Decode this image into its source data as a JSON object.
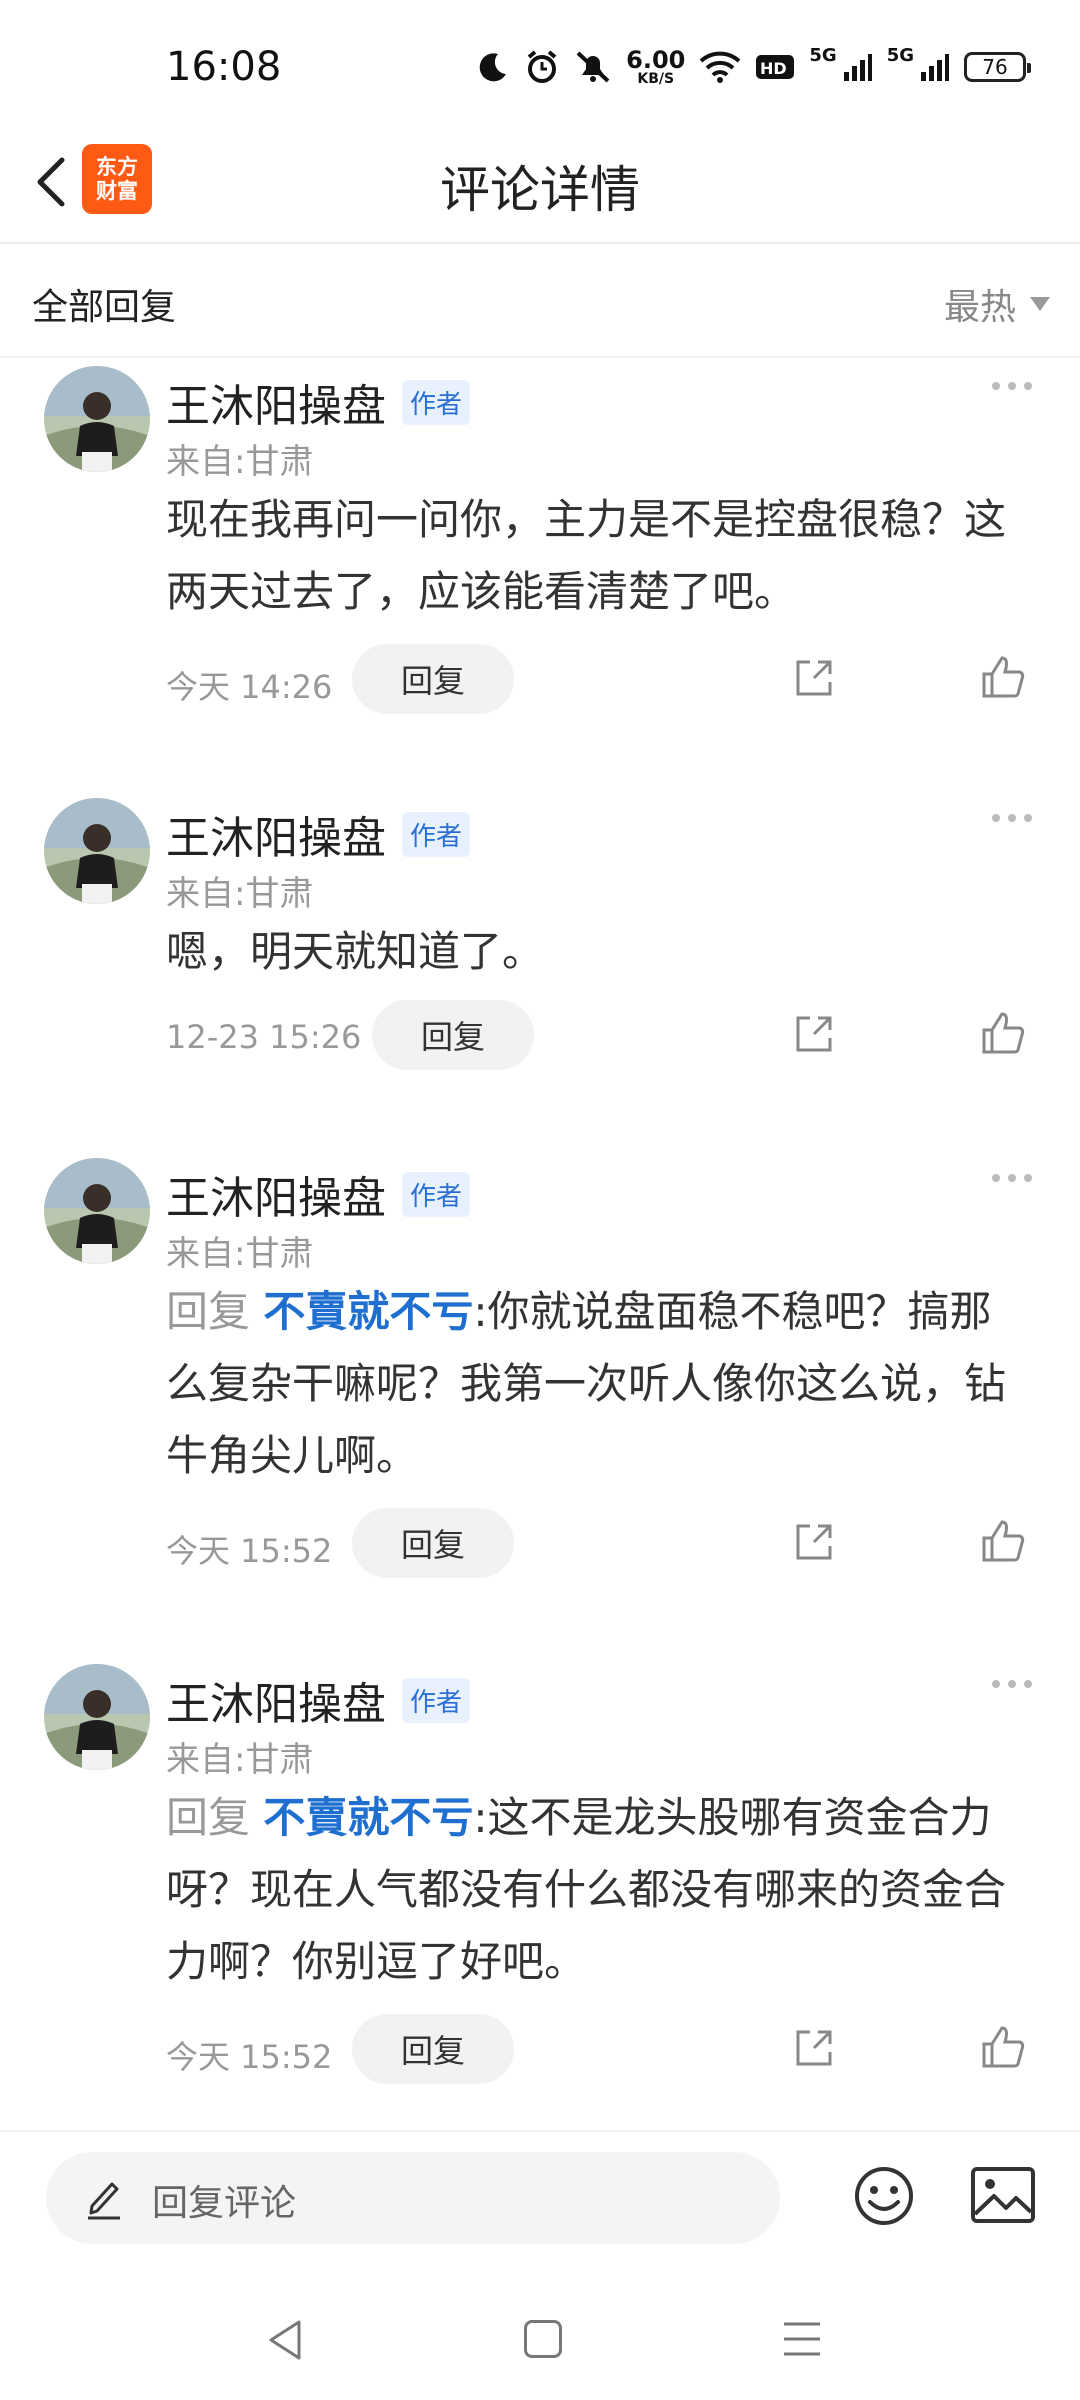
{
  "status_bar": {
    "time": "16:08",
    "net_speed_value": "6.00",
    "net_speed_unit": "KB/S",
    "hd_label": "HD",
    "signal_label_1": "5G",
    "signal_label_2": "5G",
    "battery": "76",
    "icons": [
      "moon-icon",
      "alarm-icon",
      "mute-icon",
      "wifi-icon",
      "signal-icon"
    ]
  },
  "header": {
    "title": "评论详情",
    "logo_line1": "东方",
    "logo_line2": "财富",
    "logo_color": "#ff5a14"
  },
  "filter": {
    "left_label": "全部回复",
    "sort_label": "最热"
  },
  "comments": [
    {
      "name": "王沐阳操盘",
      "badge": "作者",
      "location": "来自:甘肃",
      "reply_prefix": "",
      "reply_target": "",
      "text": "现在我再问一问你，主力是不是控盘很稳？这两天过去了，应该能看清楚了吧。",
      "date": "今天 14:26",
      "reply_label": "回复"
    },
    {
      "name": "王沐阳操盘",
      "badge": "作者",
      "location": "来自:甘肃",
      "reply_prefix": "",
      "reply_target": "",
      "text": "嗯，明天就知道了。",
      "date": "12-23 15:26",
      "reply_label": "回复"
    },
    {
      "name": "王沐阳操盘",
      "badge": "作者",
      "location": "来自:甘肃",
      "reply_prefix": "回复",
      "reply_target": "不賣就不亏",
      "text": ":你就说盘面稳不稳吧？搞那么复杂干嘛呢？我第一次听人像你这么说，钻牛角尖儿啊。",
      "date": "今天 15:52",
      "reply_label": "回复"
    },
    {
      "name": "王沐阳操盘",
      "badge": "作者",
      "location": "来自:甘肃",
      "reply_prefix": "回复",
      "reply_target": "不賣就不亏",
      "text": ":这不是龙头股哪有资金合力呀？现在人气都没有什么都没有哪来的资金合力啊？你别逗了好吧。",
      "date": "今天 15:52",
      "reply_label": "回复"
    }
  ],
  "input_bar": {
    "placeholder": "回复评论"
  },
  "colors": {
    "accent_blue": "#1f6fd1",
    "badge_bg": "#e8f1fd",
    "muted": "#999999"
  }
}
